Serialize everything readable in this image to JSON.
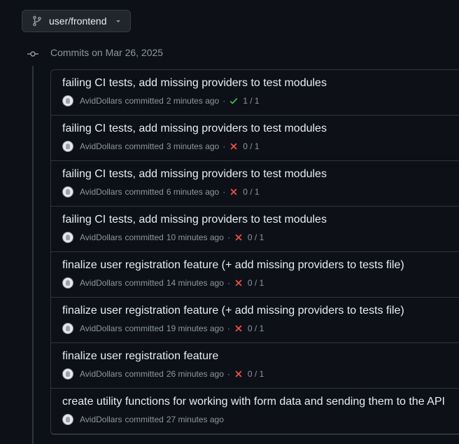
{
  "branch": {
    "name": "user/frontend",
    "icon": "git-branch-icon"
  },
  "group": {
    "title": "Commits on Mar 26, 2025"
  },
  "colors": {
    "success": "#3fb950",
    "failure": "#f85149"
  },
  "commits": [
    {
      "title": "failing CI tests, add missing providers to test modules",
      "author": "AvidDollars",
      "verb": "committed",
      "time": "2 minutes ago",
      "status": "success",
      "checks": "1 / 1"
    },
    {
      "title": "failing CI tests, add missing providers to test modules",
      "author": "AvidDollars",
      "verb": "committed",
      "time": "3 minutes ago",
      "status": "failure",
      "checks": "0 / 1"
    },
    {
      "title": "failing CI tests, add missing providers to test modules",
      "author": "AvidDollars",
      "verb": "committed",
      "time": "6 minutes ago",
      "status": "failure",
      "checks": "0 / 1"
    },
    {
      "title": "failing CI tests, add missing providers to test modules",
      "author": "AvidDollars",
      "verb": "committed",
      "time": "10 minutes ago",
      "status": "failure",
      "checks": "0 / 1"
    },
    {
      "title": "finalize user registration feature (+ add missing providers to tests file)",
      "author": "AvidDollars",
      "verb": "committed",
      "time": "14 minutes ago",
      "status": "failure",
      "checks": "0 / 1"
    },
    {
      "title": "finalize user registration feature (+ add missing providers to tests file)",
      "author": "AvidDollars",
      "verb": "committed",
      "time": "19 minutes ago",
      "status": "failure",
      "checks": "0 / 1"
    },
    {
      "title": "finalize user registration feature",
      "author": "AvidDollars",
      "verb": "committed",
      "time": "26 minutes ago",
      "status": "failure",
      "checks": "0 / 1"
    },
    {
      "title": "create utility functions for working with form data and sending them to the API",
      "author": "AvidDollars",
      "verb": "committed",
      "time": "27 minutes ago",
      "status": "none",
      "checks": ""
    }
  ]
}
